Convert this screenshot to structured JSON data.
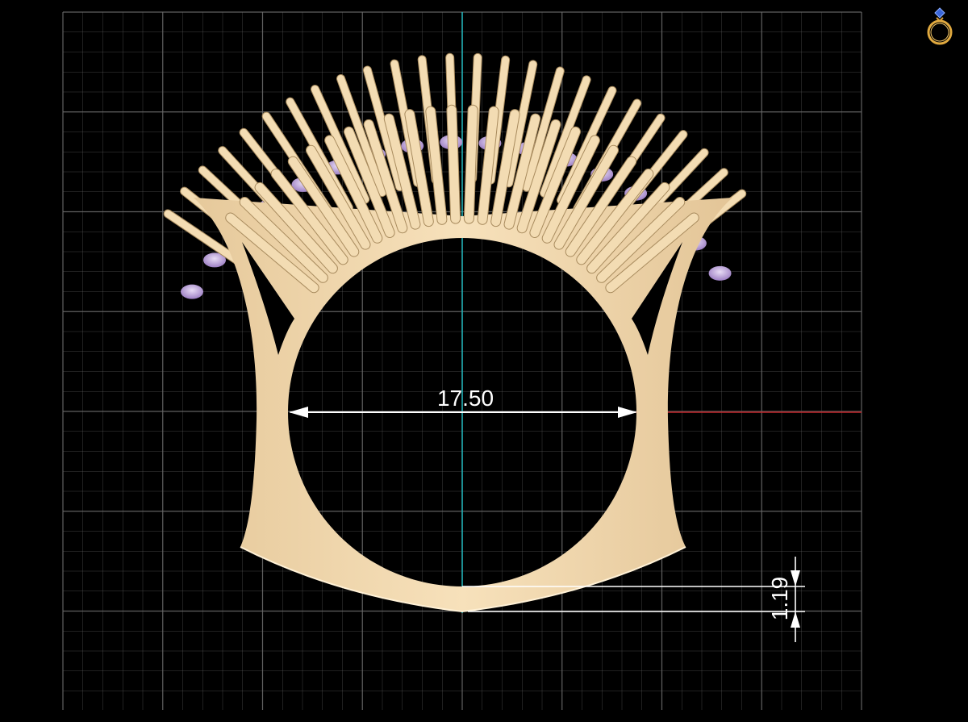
{
  "dimensions": {
    "inner_diameter": "17.50",
    "band_thickness": "1.19"
  },
  "colors": {
    "background": "#000000",
    "grid": "#6a6a6a",
    "metal": "#f3d9ae",
    "metal_shadow": "#c9ab7e",
    "gem": "#b79ad9",
    "axis_vertical": "#1fb7bd",
    "axis_horizontal": "#c0262b",
    "dimension_line": "#ffffff"
  },
  "icons": {
    "logo": "ring-icon"
  }
}
